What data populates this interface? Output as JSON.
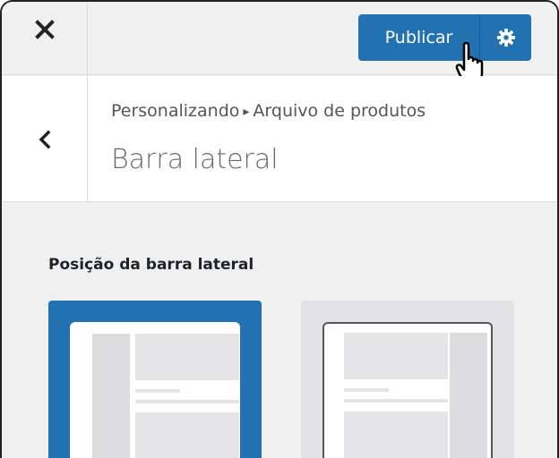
{
  "header": {
    "close_icon": "close-icon",
    "publish_label": "Publicar",
    "settings_icon": "gear-icon",
    "accent_color": "#2271b1"
  },
  "panel": {
    "back_icon": "chevron-left-icon",
    "breadcrumb_parent": "Personalizando",
    "breadcrumb_separator": "▸",
    "breadcrumb_current": "Arquivo de produtos",
    "title": "Barra lateral"
  },
  "control": {
    "label": "Posição da barra lateral",
    "options": [
      {
        "name": "sidebar-left",
        "selected": true
      },
      {
        "name": "sidebar-right",
        "selected": false
      }
    ]
  }
}
